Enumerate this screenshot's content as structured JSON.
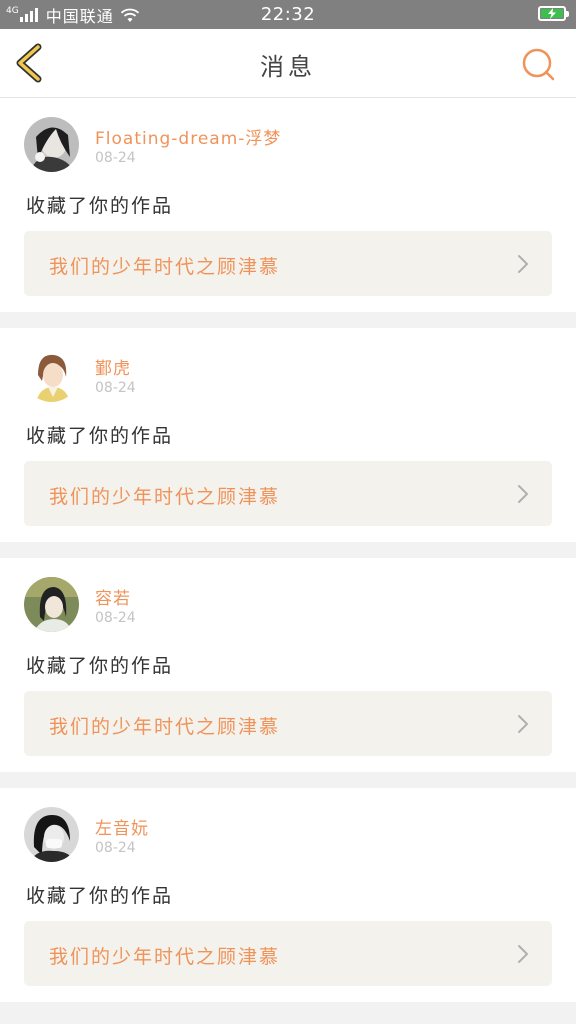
{
  "status_bar": {
    "network": "4G",
    "carrier": "中国联通",
    "time": "22:32",
    "battery_color": "#3cc04d"
  },
  "header": {
    "title": "消息",
    "back_icon": "back-chevron-icon",
    "search_icon": "search-icon",
    "accent_color": "#f0935a"
  },
  "messages": [
    {
      "username": "Floating-dream-浮梦",
      "date": "08-24",
      "action": "收藏了你的作品",
      "work_title": "我们的少年时代之顾津慕"
    },
    {
      "username": "鄞虎",
      "date": "08-24",
      "action": "收藏了你的作品",
      "work_title": "我们的少年时代之顾津慕"
    },
    {
      "username": "容若",
      "date": "08-24",
      "action": "收藏了你的作品",
      "work_title": "我们的少年时代之顾津慕"
    },
    {
      "username": "左音妧",
      "date": "08-24",
      "action": "收藏了你的作品",
      "work_title": "我们的少年时代之顾津慕"
    }
  ]
}
